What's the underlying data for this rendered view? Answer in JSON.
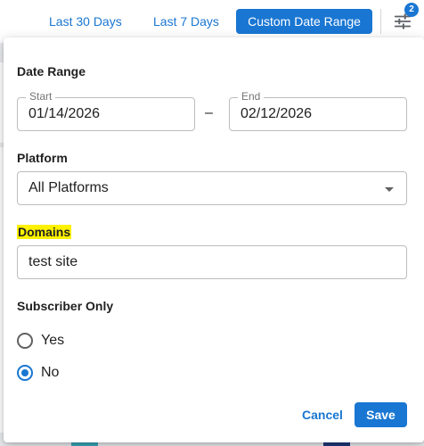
{
  "topbar": {
    "last30_label": "Last 30 Days",
    "last7_label": "Last 7 Days",
    "custom_label": "Custom Date Range",
    "filter_badge": "2"
  },
  "filter_panel": {
    "date_range": {
      "title": "Date Range",
      "start_label": "Start",
      "start_value": "01/14/2026",
      "separator": "–",
      "end_label": "End",
      "end_value": "02/12/2026"
    },
    "platform": {
      "title": "Platform",
      "selected": "All Platforms"
    },
    "domains": {
      "title": "Domains",
      "value": "test site"
    },
    "subscriber_only": {
      "title": "Subscriber Only",
      "options": [
        {
          "label": "Yes",
          "checked": false
        },
        {
          "label": "No",
          "checked": true
        }
      ]
    },
    "cancel_label": "Cancel",
    "save_label": "Save"
  },
  "colors": {
    "accent": "#1976d2",
    "highlight": "#fff200"
  }
}
